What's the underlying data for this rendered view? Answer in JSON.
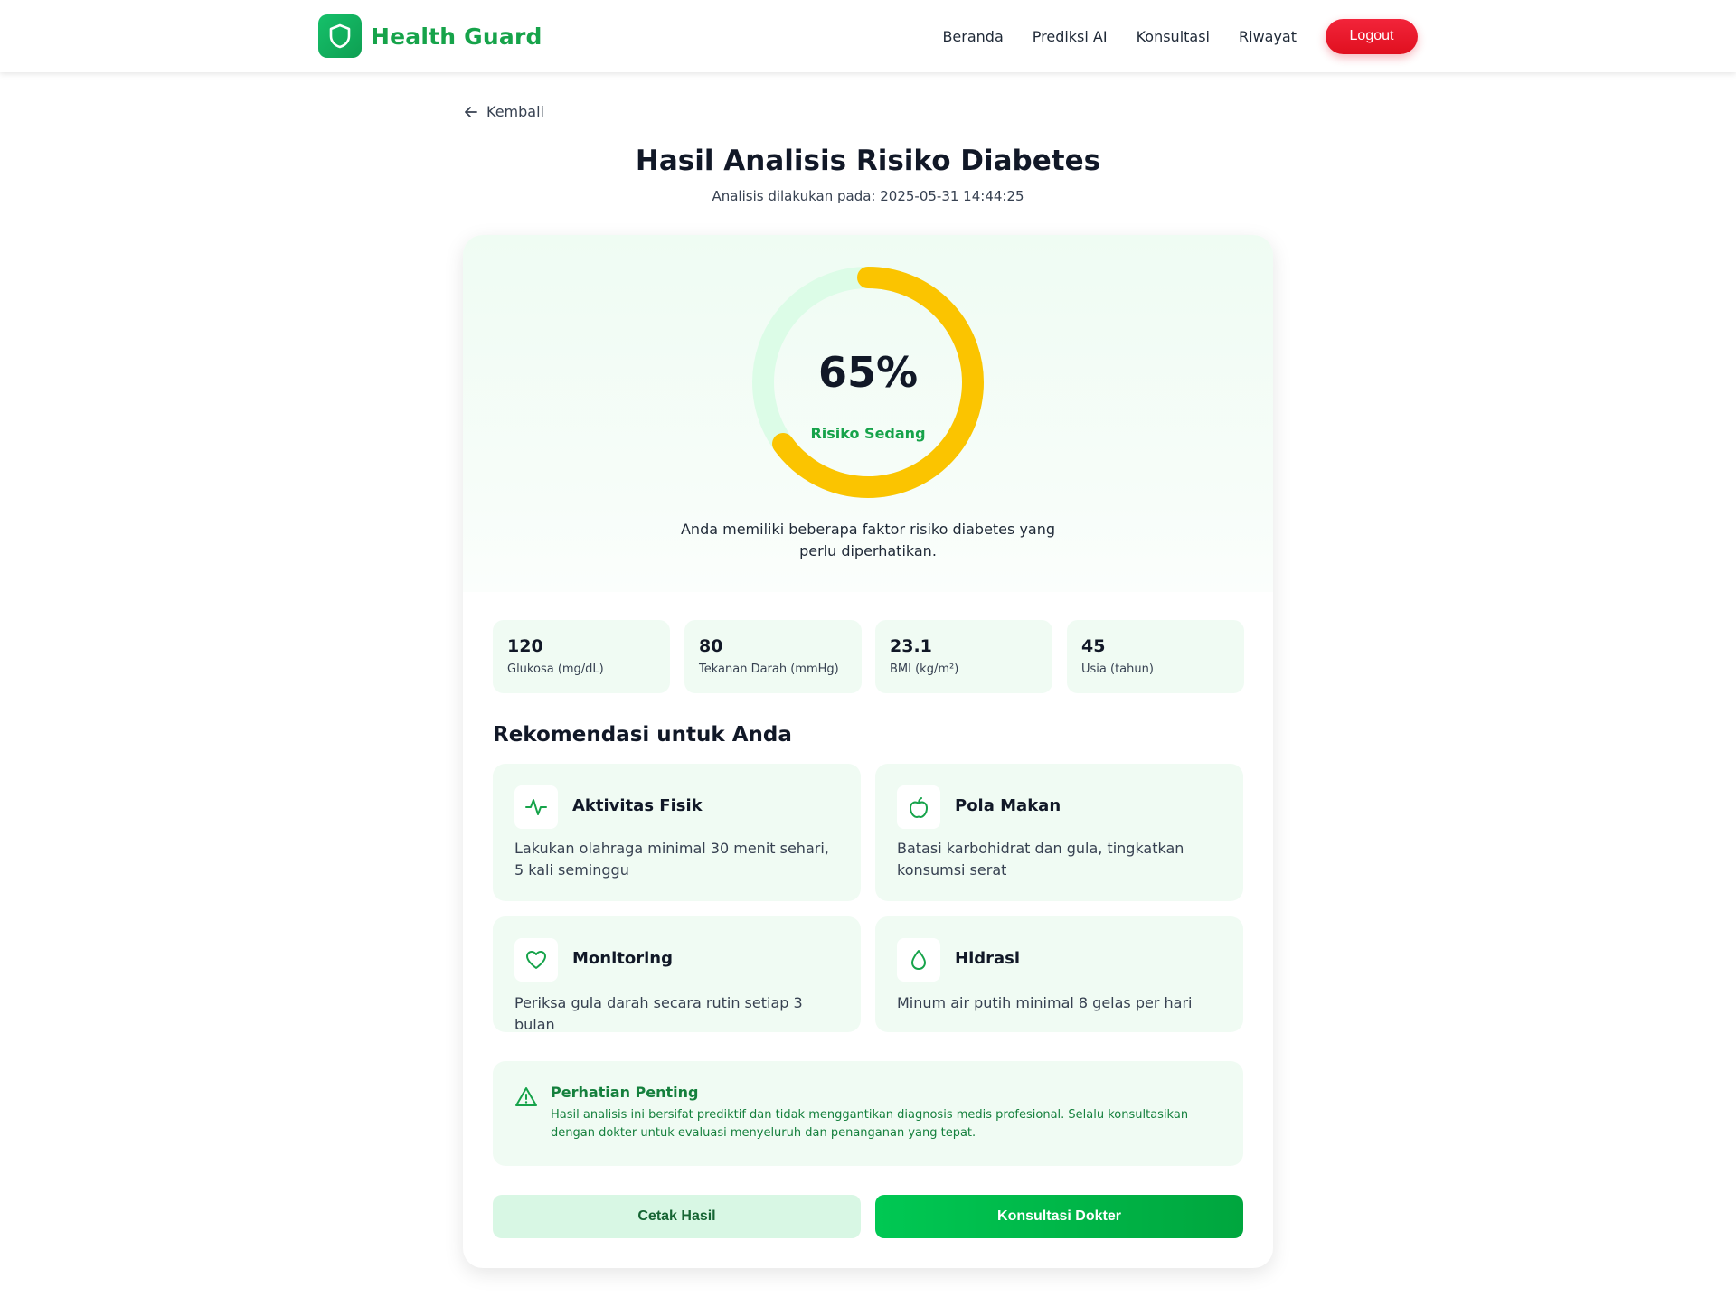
{
  "colors": {
    "brand": "#16a34a",
    "logout": "#ef1c2e",
    "gauge_progress": "#fbc400",
    "gauge_track": "#dcfce7",
    "card_tint": "#f0fbf3"
  },
  "navbar": {
    "brand_name": "Health Guard",
    "brand_icon": "shield-icon",
    "links": [
      "Beranda",
      "Prediksi AI",
      "Konsultasi",
      "Riwayat"
    ],
    "logout_label": "Logout"
  },
  "back": {
    "label": "Kembali",
    "icon": "arrow-left-icon"
  },
  "page": {
    "title": "Hasil Analisis Risiko Diabetes",
    "subtitle": "Analisis dilakukan pada: 2025-05-31 14:44:25"
  },
  "risk": {
    "percent": 65,
    "percent_label": "65%",
    "level_label": "Risiko Sedang",
    "description": "Anda memiliki beberapa faktor risiko diabetes yang perlu diperhatikan."
  },
  "metrics": [
    {
      "value": "120",
      "label": "Glukosa (mg/dL)"
    },
    {
      "value": "80",
      "label": "Tekanan Darah (mmHg)"
    },
    {
      "value": "23.1",
      "label": "BMI (kg/m²)"
    },
    {
      "value": "45",
      "label": "Usia (tahun)"
    }
  ],
  "recommendations": {
    "title": "Rekomendasi untuk Anda",
    "items": [
      {
        "icon": "activity-icon",
        "title": "Aktivitas Fisik",
        "desc": "Lakukan olahraga minimal 30 menit sehari, 5 kali seminggu"
      },
      {
        "icon": "apple-icon",
        "title": "Pola Makan",
        "desc": "Batasi karbohidrat dan gula, tingkatkan konsumsi serat"
      },
      {
        "icon": "heart-icon",
        "title": "Monitoring",
        "desc": "Periksa gula darah secara rutin setiap 3 bulan"
      },
      {
        "icon": "droplet-icon",
        "title": "Hidrasi",
        "desc": "Minum air putih minimal 8 gelas per hari"
      }
    ]
  },
  "notice": {
    "icon": "warning-triangle-icon",
    "title": "Perhatian Penting",
    "text": "Hasil analisis ini bersifat prediktif dan tidak menggantikan diagnosis medis profesional. Selalu konsultasikan dengan dokter untuk evaluasi menyeluruh dan penanganan yang tepat."
  },
  "actions": {
    "print_label": "Cetak Hasil",
    "consult_label": "Konsultasi Dokter"
  }
}
